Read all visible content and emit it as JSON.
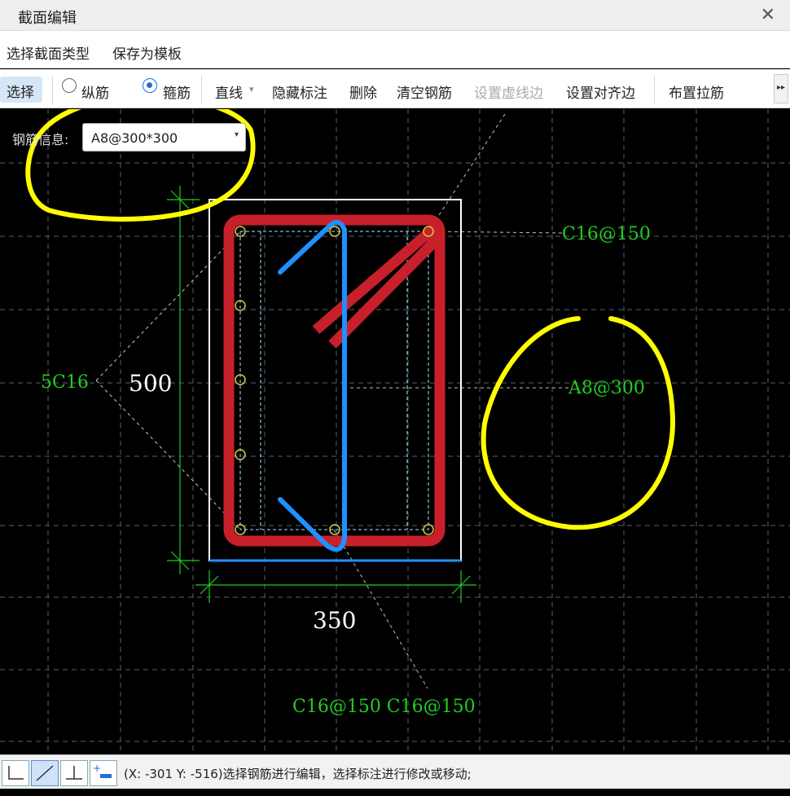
{
  "window": {
    "title": "截面编辑",
    "close_glyph": "✕"
  },
  "menu": {
    "items": [
      "选择截面类型",
      "保存为模板"
    ]
  },
  "toolbar": {
    "select": "选择",
    "longitudinal": "纵筋",
    "stirrup": "箍筋",
    "line": "直线",
    "line_arrow": "▾",
    "hide_annotation": "隐藏标注",
    "delete": "删除",
    "clear_rebar": "清空钢筋",
    "set_dashed": "设置虚线边",
    "set_align": "设置对齐边",
    "place_tie": "布置拉筋",
    "more_glyph": "▸▸"
  },
  "rebar_info": {
    "label": "钢筋信息:",
    "value": "A8@300*300",
    "arrow": "▾"
  },
  "drawing": {
    "dim_height": "500",
    "dim_width": "350",
    "label_side": "5C16",
    "label_top": "C16@150",
    "label_stirrup": "A8@300",
    "label_bottom": "C16@150 C16@150"
  },
  "status": {
    "text": "(X: -301 Y: -516)选择钢筋进行编辑，选择标注进行修改或移动;"
  },
  "colors": {
    "rebar_red": "#c8202a",
    "tie_blue": "#1e90ff",
    "annotation_green": "#22cc22",
    "highlight_yellow": "#ffff00",
    "grid": "#555a66"
  }
}
